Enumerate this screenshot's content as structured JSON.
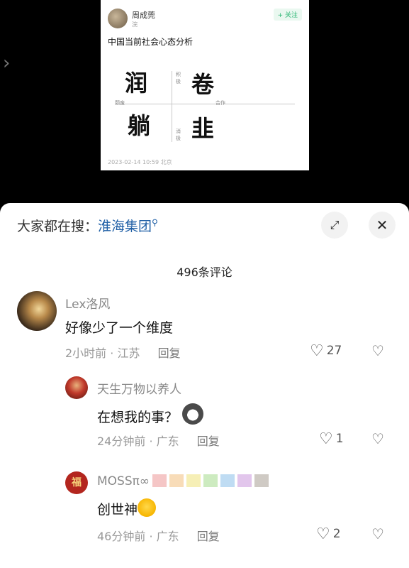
{
  "post": {
    "author": "周成莞",
    "sub": "浣",
    "follow": "+ 关注",
    "title": "中国当前社会心态分析",
    "axis_top": "积极",
    "axis_bottom": "消极",
    "axis_left": "颓废",
    "axis_right": "合作",
    "glyph_tl": "润",
    "glyph_tr": "卷",
    "glyph_bl": "躺",
    "glyph_br": "韭",
    "timestamp": "2023-02-14 10:59 北京"
  },
  "sheet": {
    "search_prefix": "大家都在搜：",
    "search_term": "淮海集团",
    "search_icon": "search-icon",
    "count_label": "496条评论"
  },
  "comments": [
    {
      "name": "Lex洛风",
      "text": "好像少了一个维度",
      "time": "2小时前",
      "location": "江苏",
      "reply": "回复",
      "likes": "27"
    },
    {
      "name": "天生万物以养人",
      "text": "在想我的事？",
      "time": "24分钟前",
      "location": "广东",
      "reply": "回复",
      "likes": "1"
    },
    {
      "name": "MOSSπ∞",
      "text": "创世神",
      "time": "46分钟前",
      "location": "广东",
      "reply": "回复",
      "likes": "2",
      "avatar_text": "福"
    }
  ],
  "swatch_colors": [
    "#f5c6c6",
    "#f8dcb8",
    "#f6efb6",
    "#cdebc0",
    "#bfdcf3",
    "#e2c6ec",
    "#cfcac4"
  ],
  "meta_separator": "·"
}
